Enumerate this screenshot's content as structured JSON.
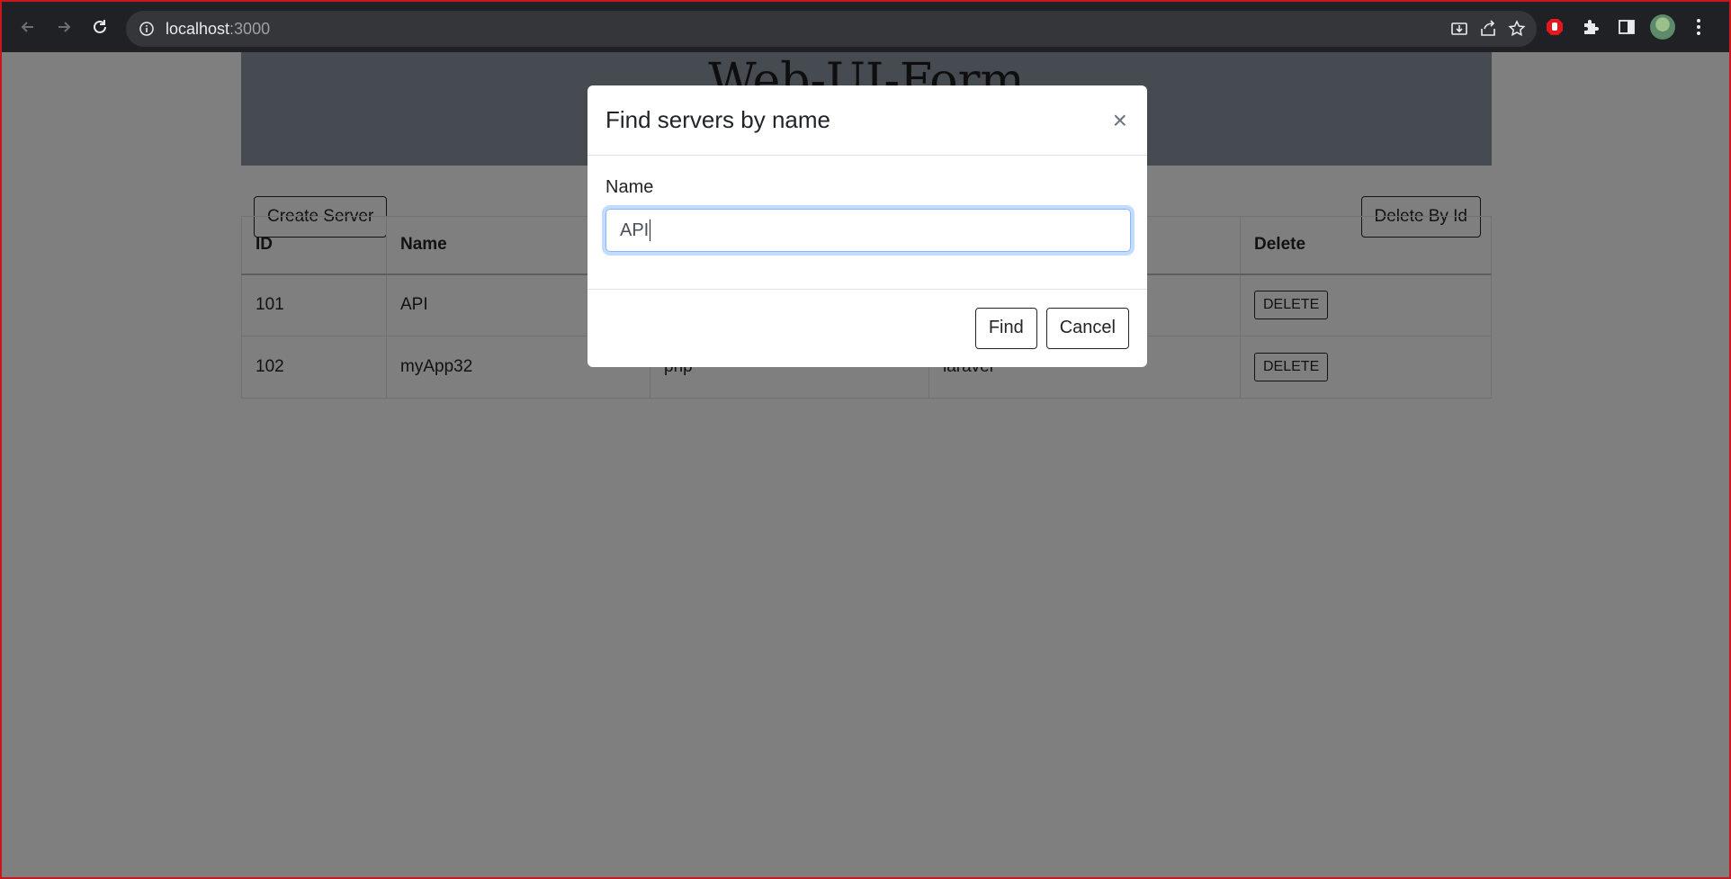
{
  "browser": {
    "url_host": "localhost",
    "url_port": ":3000",
    "icons": {
      "back": "arrow-left-icon",
      "forward": "arrow-right-icon",
      "reload": "reload-icon",
      "site_info": "info-icon",
      "install": "install-icon",
      "share": "share-icon",
      "bookmark": "star-icon",
      "extension1": "stop-hand-icon",
      "extensions": "puzzle-icon",
      "side_panel": "side-panel-icon",
      "menu": "kebab-menu-icon"
    }
  },
  "page": {
    "title": "Web-UI-Form",
    "create_label": "Create Server",
    "delete_by_id_label": "Delete By Id"
  },
  "table": {
    "headers": [
      "ID",
      "Name",
      "",
      "",
      "Delete"
    ],
    "rows": [
      {
        "id": "101",
        "name": "API",
        "language": "",
        "framework": "",
        "delete": "DELETE"
      },
      {
        "id": "102",
        "name": "myApp32",
        "language": "php",
        "framework": "laravel",
        "delete": "DELETE"
      }
    ]
  },
  "modal": {
    "title": "Find servers by name",
    "close": "×",
    "field_label": "Name",
    "field_value": "API",
    "find_label": "Find",
    "cancel_label": "Cancel"
  },
  "colors": {
    "accent_focus": "#86b7fe",
    "hero_bg": "#8d96a3",
    "frame_border": "#c8181e"
  }
}
